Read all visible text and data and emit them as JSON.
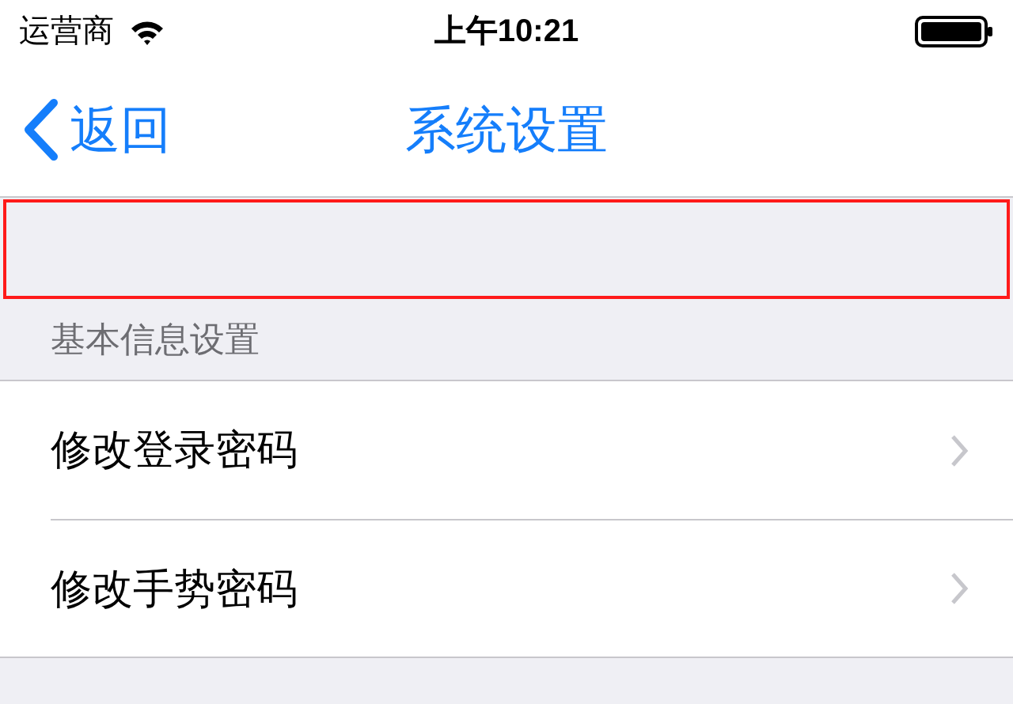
{
  "status_bar": {
    "carrier": "运营商",
    "time": "上午10:21"
  },
  "nav_bar": {
    "back": "返回",
    "title": "系统设置"
  },
  "section": {
    "header": "基本信息设置",
    "rows": [
      {
        "label": "修改登录密码"
      },
      {
        "label": "修改手势密码"
      }
    ]
  }
}
